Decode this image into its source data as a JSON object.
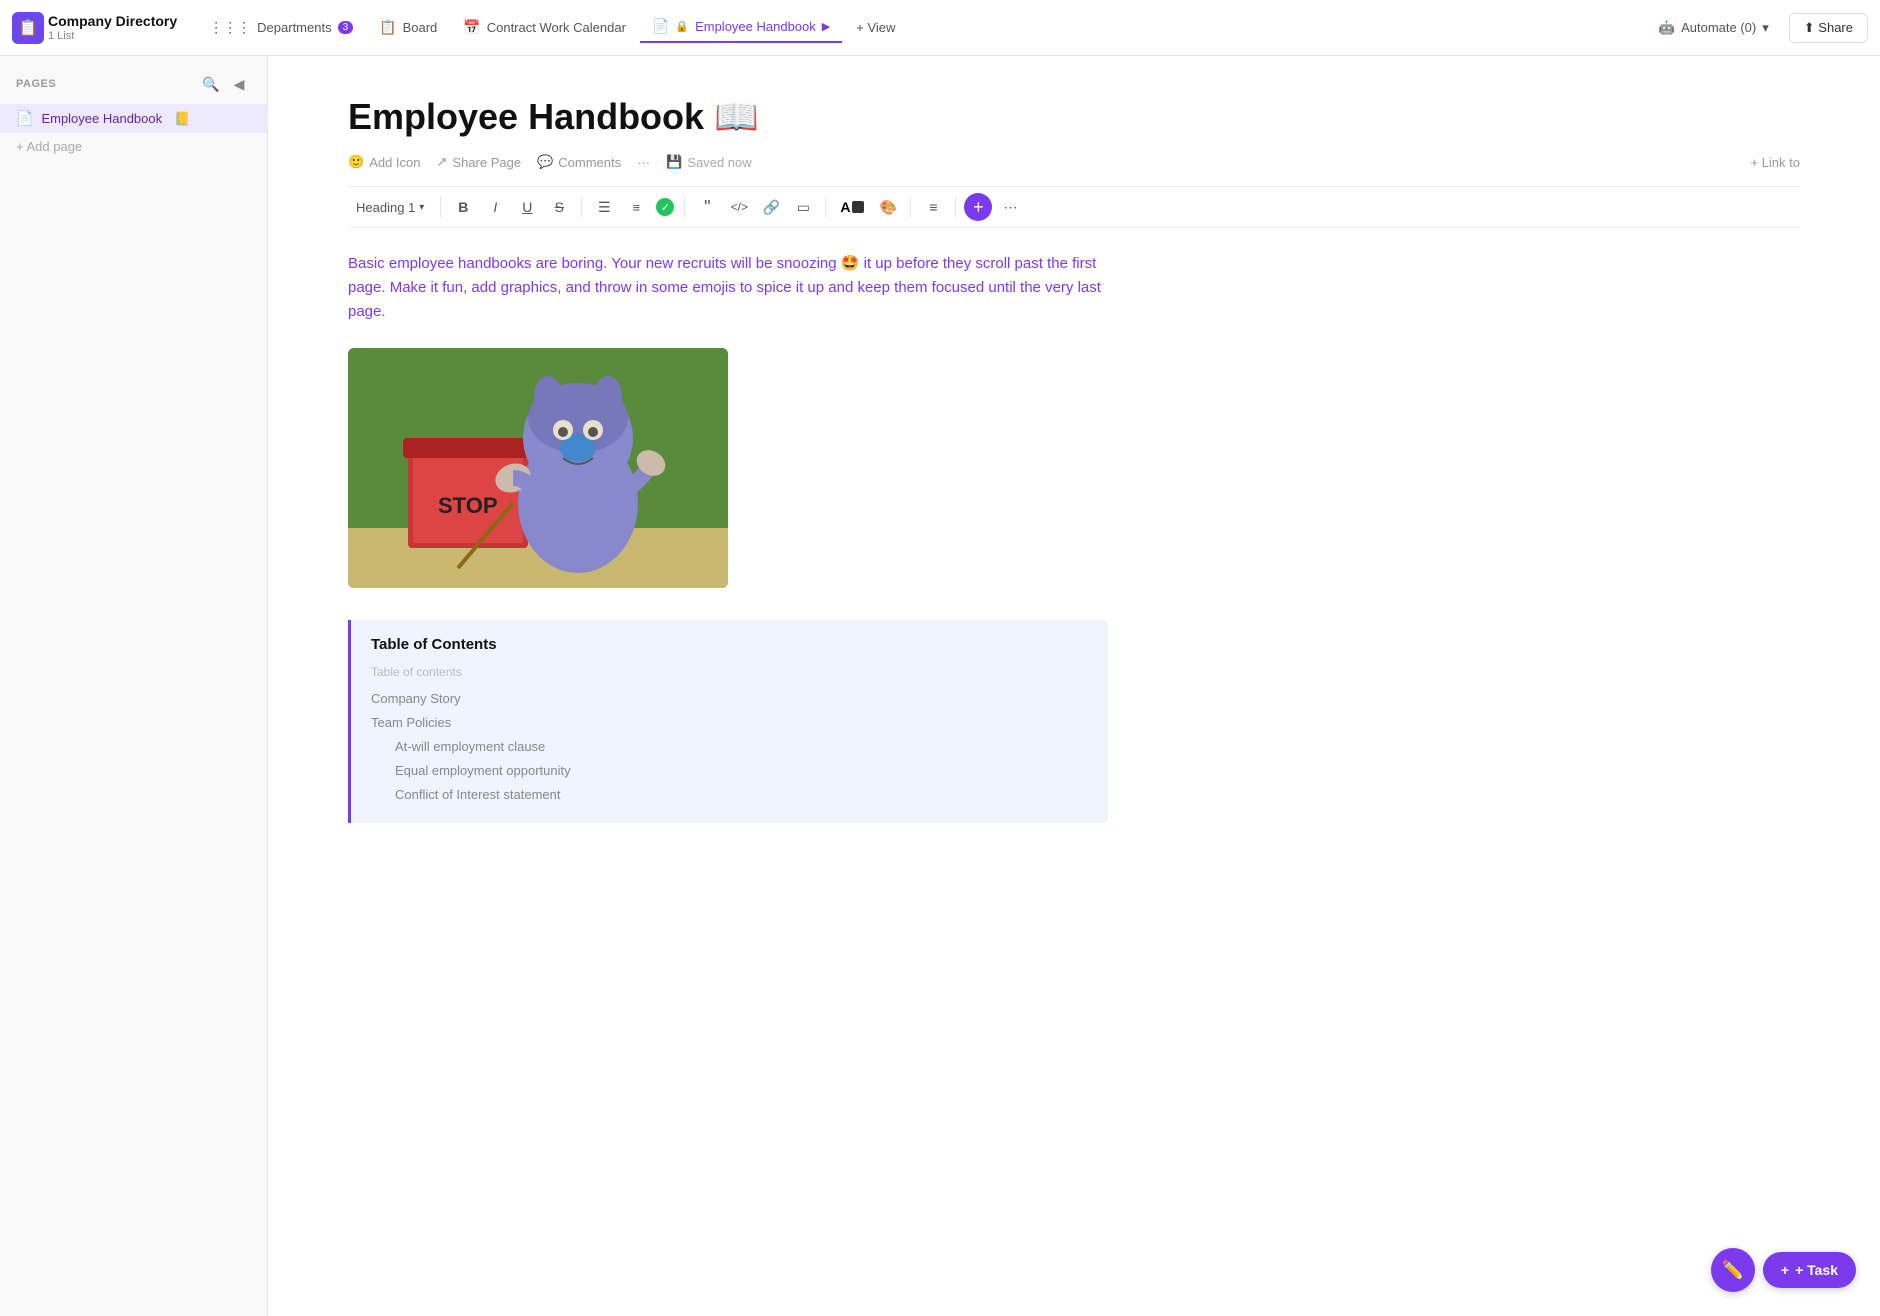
{
  "app": {
    "icon": "📋",
    "title": "Company Directory",
    "subtitle": "1 List"
  },
  "nav": {
    "tabs": [
      {
        "id": "departments",
        "label": "Departments",
        "icon": "⋮⋮⋮",
        "badge": "3",
        "active": false
      },
      {
        "id": "board",
        "label": "Board",
        "icon": "📋",
        "active": false
      },
      {
        "id": "contract-work-calendar",
        "label": "Contract Work Calendar",
        "icon": "📅",
        "active": false
      },
      {
        "id": "employee-handbook",
        "label": "Employee Handbook",
        "icon": "📄",
        "lock": true,
        "active": true
      }
    ],
    "view_label": "+ View",
    "automate_label": "Automate (0)",
    "share_label": "Share"
  },
  "sidebar": {
    "pages_label": "PAGES",
    "items": [
      {
        "id": "employee-handbook",
        "label": "Employee Handbook",
        "icon": "📋",
        "emoji": "📒",
        "active": true
      }
    ],
    "add_page_label": "+ Add page"
  },
  "document": {
    "title": "Employee Handbook 📖",
    "actions": {
      "add_icon": "Add Icon",
      "share_page": "Share Page",
      "comments": "Comments",
      "more": "...",
      "saved_status": "Saved now",
      "link_to": "+ Link to"
    },
    "toolbar": {
      "heading_dropdown": "Heading 1",
      "bold": "B",
      "italic": "I",
      "underline": "U",
      "strikethrough": "S",
      "bullet_list": "☰",
      "numbered_list": "☷",
      "check": "✓",
      "quote": "❝",
      "code": "</>",
      "link": "🔗",
      "box": "▭",
      "color_a": "A",
      "palette": "🎨",
      "align": "≡",
      "plus": "+",
      "more": "⋯"
    },
    "body_text": "Basic employee handbooks are boring. Your new recruits will be snoozing 🤩 it up before they scroll past the first page. Make it fun, add graphics, and throw in some emojis to spice it up and keep them focused until the very last page.",
    "toc": {
      "title": "Table of Contents",
      "subtitle": "Table of contents",
      "items": [
        {
          "label": "Company Story",
          "indent": 0
        },
        {
          "label": "Team Policies",
          "indent": 0
        },
        {
          "label": "At-will employment clause",
          "indent": 1
        },
        {
          "label": "Equal employment opportunity",
          "indent": 1
        },
        {
          "label": "Conflict of Interest statement",
          "indent": 1
        }
      ]
    }
  },
  "fab": {
    "edit_icon": "✏️",
    "task_label": "+ Task"
  }
}
